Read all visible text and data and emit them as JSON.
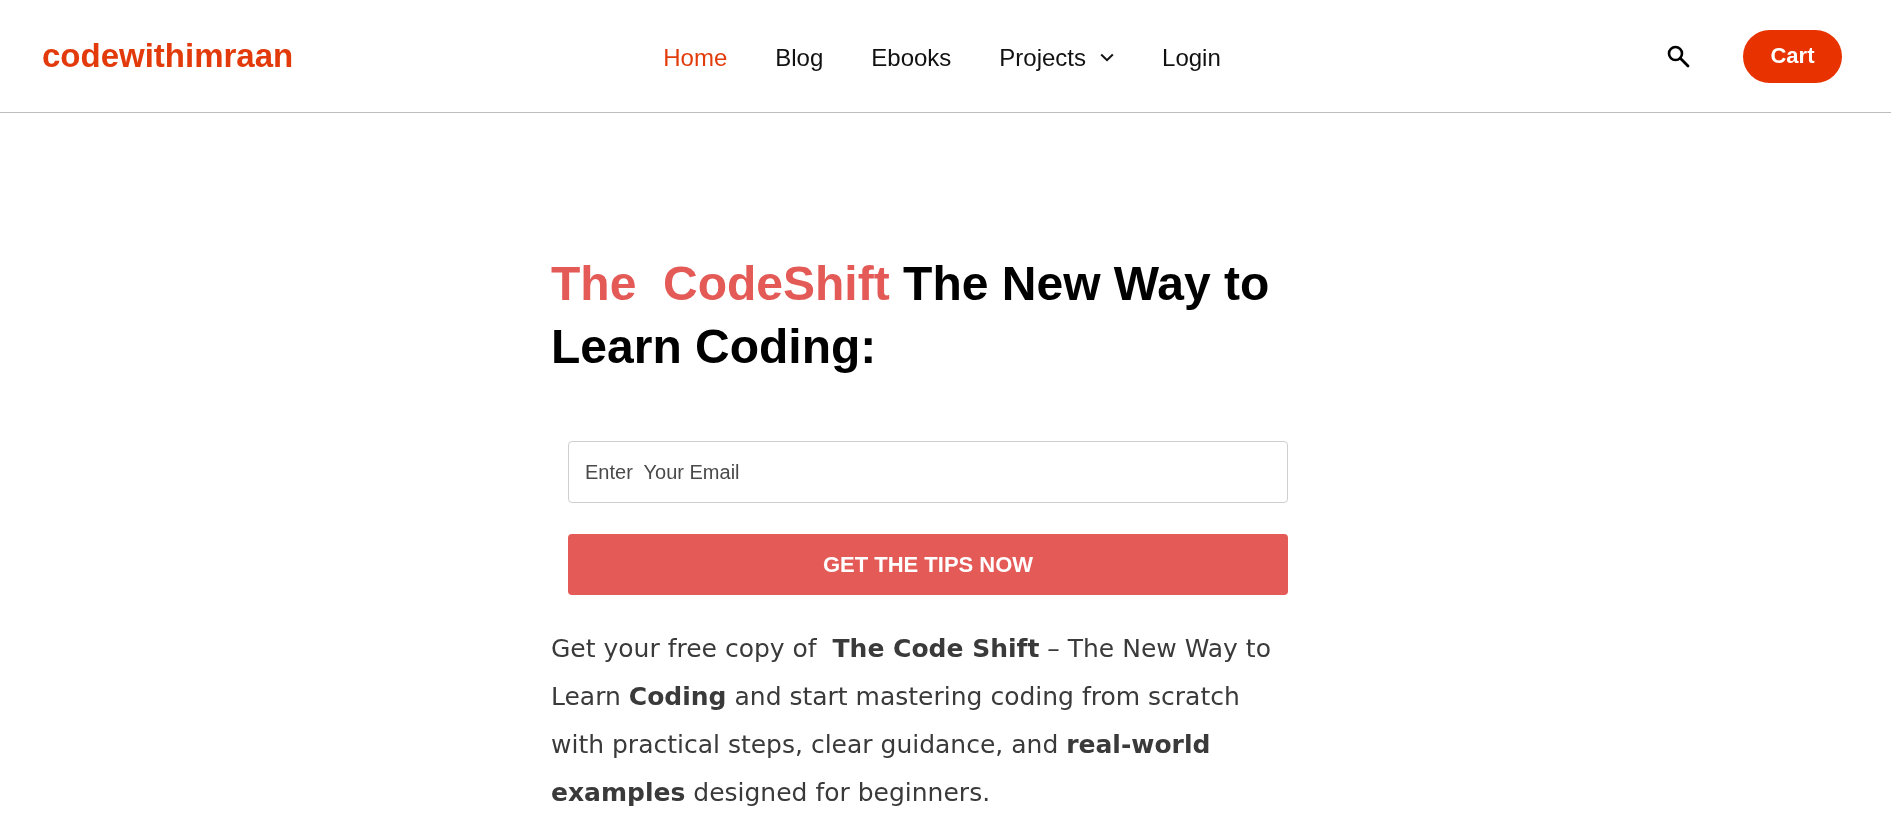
{
  "header": {
    "logo": "codewithimraan",
    "nav": [
      {
        "label": "Home",
        "selected": true,
        "kind": "link"
      },
      {
        "label": "Blog",
        "selected": false,
        "kind": "link"
      },
      {
        "label": "Ebooks",
        "selected": false,
        "kind": "link"
      },
      {
        "label": "Projects",
        "selected": false,
        "kind": "dropdown"
      },
      {
        "label": "Login",
        "selected": false,
        "kind": "link"
      }
    ],
    "cart_button": "Cart"
  },
  "hero": {
    "title_highlight": "The  CodeShift",
    "title_rest": "The New Way to Learn Coding:",
    "email_field": {
      "placeholder": "Enter  Your Email"
    },
    "submit_button": "GET THE TIPS NOW",
    "description": "Get your free copy of  **The Code Shift** – The New Way to Learn **Coding** and start mastering coding from scratch with practical steps, clear guidance, and **real-world examples** designed for beginners."
  }
}
